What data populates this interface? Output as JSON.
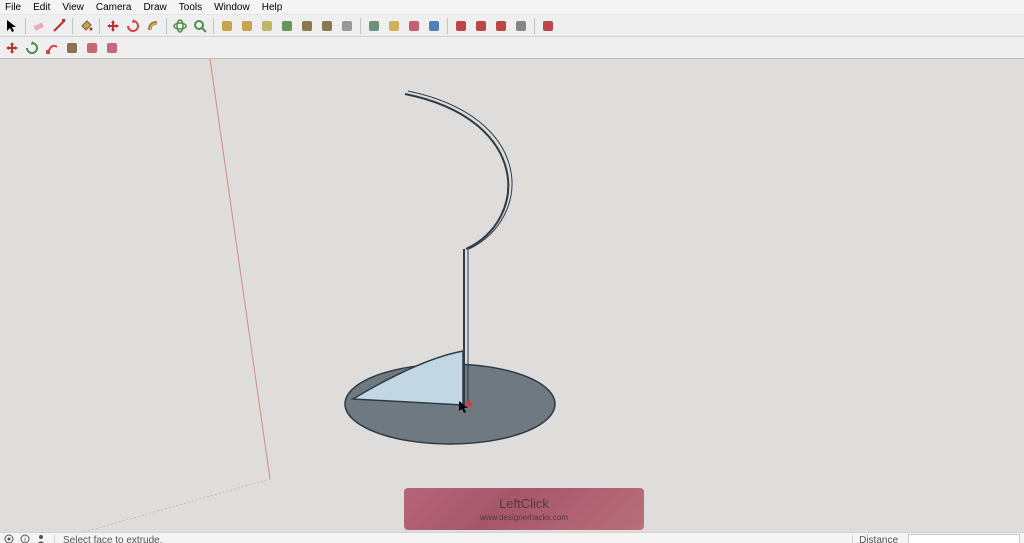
{
  "menu": {
    "items": [
      "File",
      "Edit",
      "View",
      "Camera",
      "Draw",
      "Tools",
      "Window",
      "Help"
    ]
  },
  "toolbar1": {
    "items": [
      {
        "name": "select",
        "sep_after": true
      },
      {
        "name": "eraser",
        "sep_after": false
      },
      {
        "name": "line",
        "sep_after": true
      },
      {
        "name": "paint-bucket",
        "sep_after": true
      },
      {
        "name": "move",
        "sep_after": false
      },
      {
        "name": "rotate",
        "sep_after": false
      },
      {
        "name": "offset",
        "sep_after": true
      },
      {
        "name": "orbit",
        "sep_after": false
      },
      {
        "name": "zoom-extents",
        "sep_after": true
      },
      {
        "name": "round-corner-a",
        "sep_after": false
      },
      {
        "name": "round-corner-b",
        "sep_after": false
      },
      {
        "name": "round-corner-c",
        "sep_after": false
      },
      {
        "name": "round-corner-d",
        "sep_after": false
      },
      {
        "name": "edge-tools-a",
        "sep_after": false
      },
      {
        "name": "edge-tools-b",
        "sep_after": false
      },
      {
        "name": "platform",
        "sep_after": true
      },
      {
        "name": "solid-a",
        "sep_after": false
      },
      {
        "name": "solid-b",
        "sep_after": false
      },
      {
        "name": "artisan-a",
        "sep_after": false
      },
      {
        "name": "artisan-b",
        "sep_after": true
      },
      {
        "name": "plugin-a",
        "sep_after": false
      },
      {
        "name": "plugin-b",
        "sep_after": false
      },
      {
        "name": "plugin-c",
        "sep_after": false
      },
      {
        "name": "plugin-d",
        "sep_after": true
      },
      {
        "name": "plugin-e",
        "sep_after": false
      }
    ]
  },
  "toolbar2": {
    "items": [
      {
        "name": "move-ext",
        "sep_after": false
      },
      {
        "name": "rotate-ext",
        "sep_after": false
      },
      {
        "name": "follow-me",
        "sep_after": false
      },
      {
        "name": "followme-ext",
        "sep_after": false
      },
      {
        "name": "ext-a",
        "sep_after": false
      },
      {
        "name": "ext-b",
        "sep_after": false
      }
    ]
  },
  "watermark": {
    "title": "LeftClick",
    "subtitle": "www.designerhacks.com"
  },
  "status": {
    "hint": "Select face to extrude.",
    "distance_label": "Distance"
  }
}
